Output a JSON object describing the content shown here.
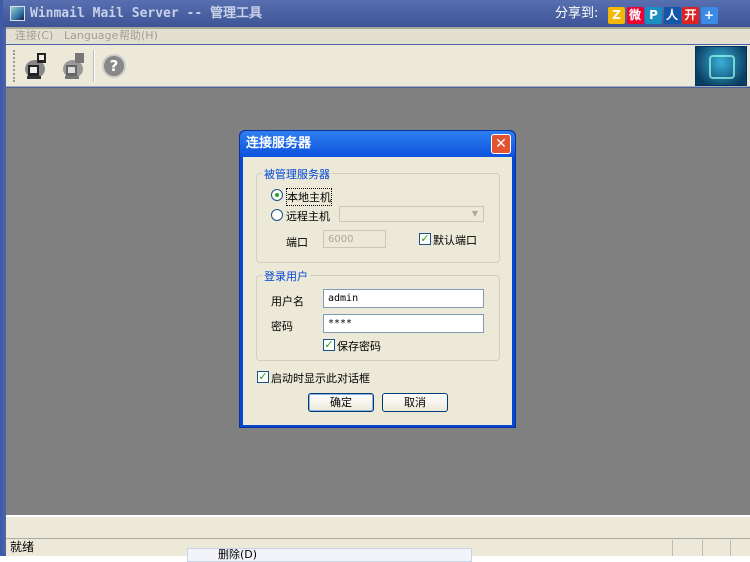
{
  "window": {
    "title": "Winmail Mail Server -- 管理工具",
    "share_label": "分享到:"
  },
  "share_icons": [
    {
      "name": "qzone-icon",
      "glyph": "Z",
      "color": "#f5b800"
    },
    {
      "name": "weibo-icon",
      "glyph": "微",
      "color": "#e03"
    },
    {
      "name": "tencent-weibo-icon",
      "glyph": "P",
      "color": "#1a8fc0"
    },
    {
      "name": "renren-icon",
      "glyph": "人",
      "color": "#1456a8"
    },
    {
      "name": "kaixin-icon",
      "glyph": "开",
      "color": "#d22"
    },
    {
      "name": "more-share-icon",
      "glyph": "+",
      "color": "#3b8ae6"
    }
  ],
  "menu": [
    "连接(C)",
    "Language",
    "帮助(H)"
  ],
  "toolbar": {
    "buttons": [
      "connect",
      "disconnect",
      "help"
    ]
  },
  "status": {
    "text": "就绪"
  },
  "popup": {
    "item": "删除(D)"
  },
  "dialog": {
    "title": "连接服务器",
    "server_group": {
      "label": "被管理服务器",
      "local": "本地主机",
      "remote": "远程主机",
      "remote_selected": true,
      "local_selected": true,
      "remote_value": "",
      "port_label": "端口",
      "port_value": "6000",
      "default_port_label": "默认端口",
      "default_port_checked": true
    },
    "user_group": {
      "label": "登录用户",
      "username_label": "用户名",
      "username": "admin",
      "password_label": "密码",
      "password": "****",
      "save_password_label": "保存密码",
      "save_password_checked": true
    },
    "show_on_startup_label": "启动时显示此对话框",
    "show_on_startup_checked": true,
    "ok": "确定",
    "cancel": "取消"
  }
}
